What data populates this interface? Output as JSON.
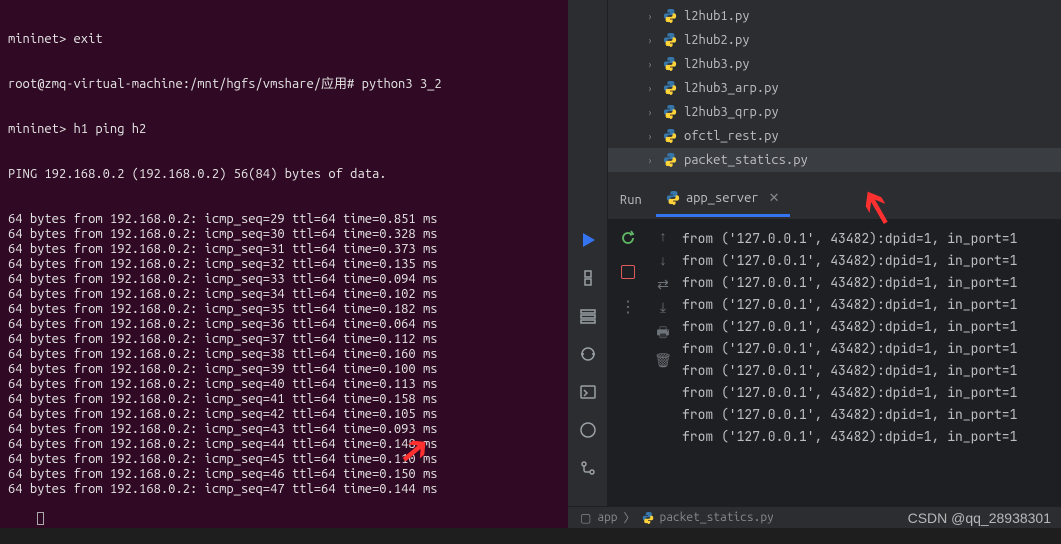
{
  "terminal": {
    "line1": "mininet> exit",
    "line2": "root@zmq-virtual-machine:/mnt/hgfs/vmshare/应用# python3 3_2",
    "line3": "mininet> h1 ping h2",
    "line4": "PING 192.168.0.2 (192.168.0.2) 56(84) bytes of data.",
    "pings": [
      "64 bytes from 192.168.0.2: icmp_seq=29 ttl=64 time=0.851 ms",
      "64 bytes from 192.168.0.2: icmp_seq=30 ttl=64 time=0.328 ms",
      "64 bytes from 192.168.0.2: icmp_seq=31 ttl=64 time=0.373 ms",
      "64 bytes from 192.168.0.2: icmp_seq=32 ttl=64 time=0.135 ms",
      "64 bytes from 192.168.0.2: icmp_seq=33 ttl=64 time=0.094 ms",
      "64 bytes from 192.168.0.2: icmp_seq=34 ttl=64 time=0.102 ms",
      "64 bytes from 192.168.0.2: icmp_seq=35 ttl=64 time=0.182 ms",
      "64 bytes from 192.168.0.2: icmp_seq=36 ttl=64 time=0.064 ms",
      "64 bytes from 192.168.0.2: icmp_seq=37 ttl=64 time=0.112 ms",
      "64 bytes from 192.168.0.2: icmp_seq=38 ttl=64 time=0.160 ms",
      "64 bytes from 192.168.0.2: icmp_seq=39 ttl=64 time=0.100 ms",
      "64 bytes from 192.168.0.2: icmp_seq=40 ttl=64 time=0.113 ms",
      "64 bytes from 192.168.0.2: icmp_seq=41 ttl=64 time=0.158 ms",
      "64 bytes from 192.168.0.2: icmp_seq=42 ttl=64 time=0.105 ms",
      "64 bytes from 192.168.0.2: icmp_seq=43 ttl=64 time=0.093 ms",
      "64 bytes from 192.168.0.2: icmp_seq=44 ttl=64 time=0.148 ms",
      "64 bytes from 192.168.0.2: icmp_seq=45 ttl=64 time=0.110 ms",
      "64 bytes from 192.168.0.2: icmp_seq=46 ttl=64 time=0.150 ms",
      "64 bytes from 192.168.0.2: icmp_seq=47 ttl=64 time=0.144 ms"
    ]
  },
  "files": [
    {
      "name": "l2hub1.py"
    },
    {
      "name": "l2hub2.py"
    },
    {
      "name": "l2hub3.py"
    },
    {
      "name": "l2hub3_arp.py"
    },
    {
      "name": "l2hub3_qrp.py"
    },
    {
      "name": "ofctl_rest.py"
    },
    {
      "name": "packet_statics.py"
    }
  ],
  "run": {
    "label": "Run",
    "tab": "app_server"
  },
  "console": {
    "lines": [
      "from ('127.0.0.1', 43482):dpid=1, in_port=1",
      "from ('127.0.0.1', 43482):dpid=1, in_port=1",
      "from ('127.0.0.1', 43482):dpid=1, in_port=1",
      "from ('127.0.0.1', 43482):dpid=1, in_port=1",
      "from ('127.0.0.1', 43482):dpid=1, in_port=1",
      "from ('127.0.0.1', 43482):dpid=1, in_port=1",
      "from ('127.0.0.1', 43482):dpid=1, in_port=1",
      "from ('127.0.0.1', 43482):dpid=1, in_port=1",
      "from ('127.0.0.1', 43482):dpid=1, in_port=1",
      "from ('127.0.0.1', 43482):dpid=1, in_port=1"
    ]
  },
  "breadcrumb": {
    "folder": "app",
    "file": "packet_statics.py",
    "sep": "〉"
  },
  "watermark": "CSDN @qq_28938301"
}
